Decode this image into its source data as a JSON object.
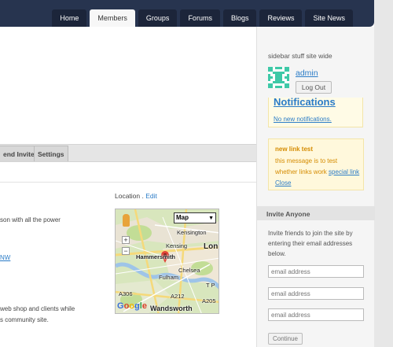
{
  "nav": {
    "items": [
      {
        "label": "Home",
        "active": false
      },
      {
        "label": "Members",
        "active": true
      },
      {
        "label": "Groups",
        "active": false
      },
      {
        "label": "Forums",
        "active": false
      },
      {
        "label": "Blogs",
        "active": false
      },
      {
        "label": "Reviews",
        "active": false
      },
      {
        "label": "Site News",
        "active": false
      }
    ]
  },
  "profile_tabs": {
    "send_invites": "end Invites",
    "settings": "Settings"
  },
  "location": {
    "label": "Location",
    "separator": ".",
    "edit_label": "Edit"
  },
  "body_text": {
    "line1": "son with all the power",
    "link": "NW",
    "line2": "web shop and clients while",
    "line3": "s community site."
  },
  "map": {
    "type_label": "Map",
    "zoom_in": "+",
    "zoom_out": "−",
    "labels": {
      "kensington": "Kensington",
      "lon": "Lon",
      "hammersmith": "Hammersmith",
      "chelsea": "Chelsea",
      "fulham": "Fulham",
      "wandsworth": "Wandsworth",
      "a212": "A212",
      "a306": "A306",
      "a205": "A205",
      "kensing": "Kensing",
      "tp": "T P"
    },
    "logo": "Google",
    "colors": {
      "park": "#c6e0a1",
      "water": "#9ec4e8",
      "road": "#f5d97a"
    }
  },
  "sidebar": {
    "title": "sidebar stuff site wide",
    "user": "admin",
    "logout_label": "Log Out",
    "notifications": {
      "title": "Notifications",
      "empty": "No new notifications."
    },
    "link_test": {
      "title": "new link test",
      "body": "this message is to test whether links work",
      "special_link": "special link",
      "close_link": "Close"
    },
    "invite": {
      "title": "Invite Anyone",
      "description": "Invite friends to join the site by entering their email addresses below.",
      "email_placeholder": "email address",
      "continue_label": "Continue"
    }
  },
  "colors": {
    "topbar": "#27344f",
    "link": "#2b7cc7",
    "notice_text": "#d58b00"
  }
}
